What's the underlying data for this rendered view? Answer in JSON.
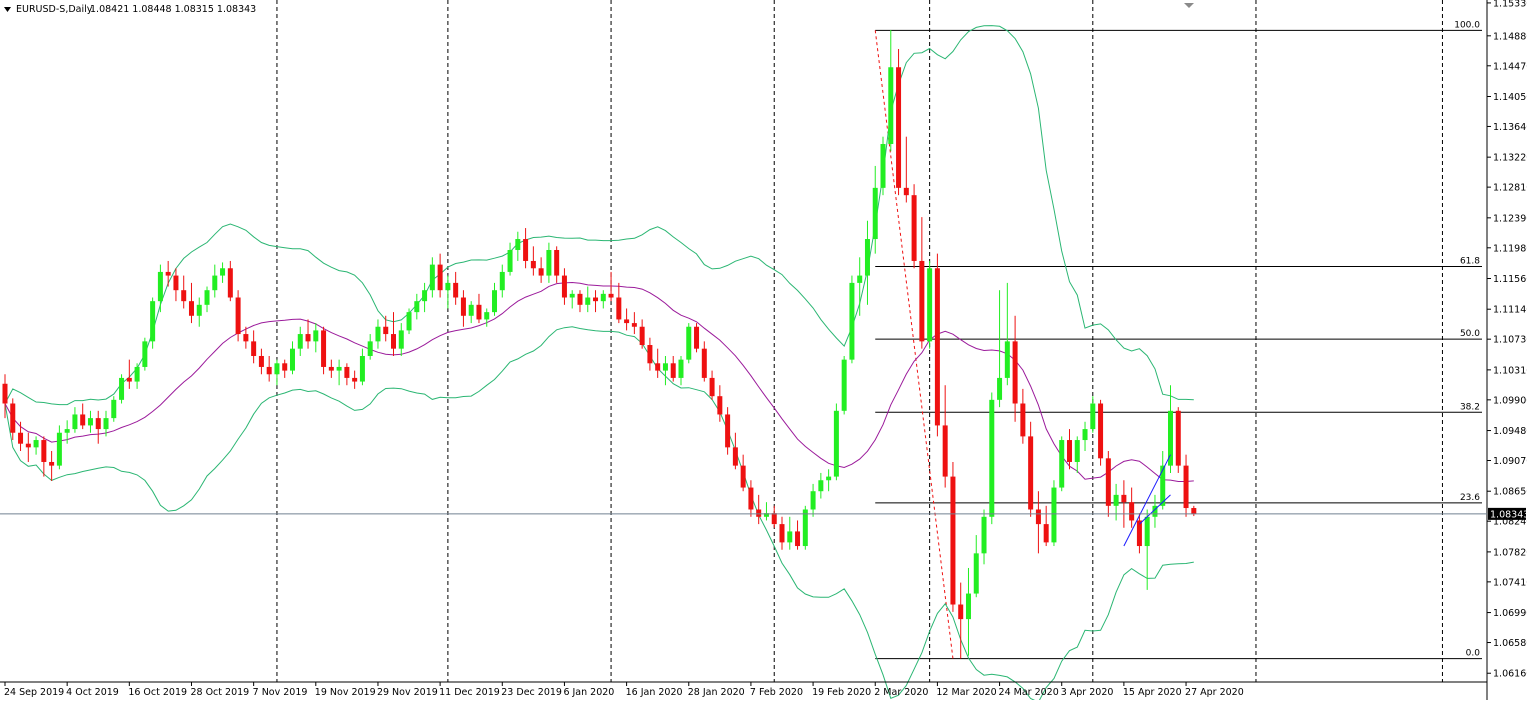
{
  "header": {
    "symbol": "EURUSD-S,Daily",
    "ohlc": "1.08421 1.08448 1.08315 1.08343"
  },
  "price_marker": "1.08343",
  "colors": {
    "bull": "#22ee22",
    "bear": "#ee1111",
    "bands": "#2bb673",
    "mid": "#9b1b9b",
    "fib": "#000000",
    "bid_line": "#708090",
    "trend": "#1a1aff"
  },
  "chart_data": {
    "type": "candlestick",
    "title": "EURUSD-S,Daily",
    "y_ticks": [
      "1.15330",
      "1.14880",
      "1.14470",
      "1.14050",
      "1.13640",
      "1.13220",
      "1.12810",
      "1.12390",
      "1.11980",
      "1.11560",
      "1.11140",
      "1.10730",
      "1.10310",
      "1.09900",
      "1.09480",
      "1.09070",
      "1.08650",
      "1.08240",
      "1.07820",
      "1.07410",
      "1.06990",
      "1.06580",
      "1.06160"
    ],
    "ylim": [
      1.0604,
      1.1537
    ],
    "x_labels": [
      "24 Sep 2019",
      "4 Oct 2019",
      "16 Oct 2019",
      "28 Oct 2019",
      "7 Nov 2019",
      "19 Nov 2019",
      "29 Nov 2019",
      "11 Dec 2019",
      "23 Dec 2019",
      "6 Jan 2020",
      "16 Jan 2020",
      "28 Jan 2020",
      "7 Feb 2020",
      "19 Feb 2020",
      "2 Mar 2020",
      "12 Mar 2020",
      "24 Mar 2020",
      "3 Apr 2020",
      "15 Apr 2020",
      "27 Apr 2020"
    ],
    "fibonacci": [
      {
        "label": "100.0",
        "price": 1.14955
      },
      {
        "label": "61.8",
        "price": 1.11725
      },
      {
        "label": "50.0",
        "price": 1.1073
      },
      {
        "label": "38.2",
        "price": 1.0973
      },
      {
        "label": "23.6",
        "price": 1.0849
      },
      {
        "label": "0.0",
        "price": 1.0636
      }
    ],
    "candles": [
      [
        1.1012,
        1.1025,
        1.0965,
        1.0985
      ],
      [
        1.0985,
        1.0992,
        1.0935,
        1.0945
      ],
      [
        1.0945,
        1.096,
        1.092,
        1.093
      ],
      [
        1.093,
        1.0945,
        1.0905,
        1.0925
      ],
      [
        1.0925,
        1.094,
        1.0915,
        1.0935
      ],
      [
        1.0935,
        1.094,
        1.0885,
        1.0905
      ],
      [
        1.0905,
        1.092,
        1.0879,
        1.09
      ],
      [
        1.09,
        1.0955,
        1.0895,
        1.0945
      ],
      [
        1.0945,
        1.0962,
        1.093,
        1.095
      ],
      [
        1.095,
        1.098,
        1.0945,
        1.097
      ],
      [
        1.097,
        1.0985,
        1.095,
        1.0955
      ],
      [
        1.0955,
        1.0975,
        1.0945,
        1.0965
      ],
      [
        1.0965,
        1.0975,
        1.093,
        1.095
      ],
      [
        1.095,
        1.0975,
        1.094,
        1.0965
      ],
      [
        1.0965,
        1.0995,
        1.096,
        1.099
      ],
      [
        1.099,
        1.1025,
        1.0985,
        1.102
      ],
      [
        1.102,
        1.1045,
        1.1005,
        1.1015
      ],
      [
        1.1015,
        1.104,
        1.1005,
        1.1035
      ],
      [
        1.1035,
        1.1075,
        1.103,
        1.107
      ],
      [
        1.107,
        1.113,
        1.106,
        1.1125
      ],
      [
        1.1125,
        1.1175,
        1.111,
        1.1165
      ],
      [
        1.1165,
        1.118,
        1.1145,
        1.116
      ],
      [
        1.116,
        1.117,
        1.1125,
        1.114
      ],
      [
        1.114,
        1.116,
        1.1115,
        1.1125
      ],
      [
        1.1125,
        1.115,
        1.1095,
        1.1105
      ],
      [
        1.1105,
        1.113,
        1.109,
        1.112
      ],
      [
        1.112,
        1.1145,
        1.111,
        1.114
      ],
      [
        1.114,
        1.1175,
        1.113,
        1.116
      ],
      [
        1.116,
        1.1178,
        1.115,
        1.117
      ],
      [
        1.117,
        1.118,
        1.1125,
        1.113
      ],
      [
        1.113,
        1.114,
        1.107,
        1.108
      ],
      [
        1.108,
        1.109,
        1.106,
        1.107
      ],
      [
        1.107,
        1.1085,
        1.104,
        1.105
      ],
      [
        1.105,
        1.106,
        1.1025,
        1.1035
      ],
      [
        1.1035,
        1.105,
        1.1015,
        1.1025
      ],
      [
        1.1025,
        1.1045,
        1.101,
        1.104
      ],
      [
        1.104,
        1.1045,
        1.102,
        1.103
      ],
      [
        1.103,
        1.107,
        1.1025,
        1.106
      ],
      [
        1.106,
        1.109,
        1.105,
        1.108
      ],
      [
        1.108,
        1.11,
        1.106,
        1.107
      ],
      [
        1.107,
        1.1095,
        1.1055,
        1.1085
      ],
      [
        1.1085,
        1.109,
        1.1025,
        1.1035
      ],
      [
        1.1035,
        1.1045,
        1.102,
        1.103
      ],
      [
        1.103,
        1.1045,
        1.101,
        1.1035
      ],
      [
        1.1035,
        1.104,
        1.101,
        1.102
      ],
      [
        1.102,
        1.103,
        1.1005,
        1.1015
      ],
      [
        1.1015,
        1.106,
        1.101,
        1.105
      ],
      [
        1.105,
        1.108,
        1.1045,
        1.107
      ],
      [
        1.107,
        1.11,
        1.106,
        1.109
      ],
      [
        1.109,
        1.1105,
        1.107,
        1.108
      ],
      [
        1.108,
        1.111,
        1.105,
        1.106
      ],
      [
        1.106,
        1.1095,
        1.105,
        1.1085
      ],
      [
        1.1085,
        1.1115,
        1.108,
        1.111
      ],
      [
        1.111,
        1.1135,
        1.11,
        1.1125
      ],
      [
        1.1125,
        1.115,
        1.111,
        1.114
      ],
      [
        1.114,
        1.1185,
        1.113,
        1.1175
      ],
      [
        1.1175,
        1.119,
        1.113,
        1.114
      ],
      [
        1.114,
        1.116,
        1.1115,
        1.115
      ],
      [
        1.115,
        1.1165,
        1.112,
        1.113
      ],
      [
        1.113,
        1.114,
        1.109,
        1.1105
      ],
      [
        1.1105,
        1.1125,
        1.1095,
        1.112
      ],
      [
        1.112,
        1.1135,
        1.1095,
        1.11
      ],
      [
        1.11,
        1.1115,
        1.109,
        1.111
      ],
      [
        1.111,
        1.115,
        1.1105,
        1.114
      ],
      [
        1.114,
        1.1175,
        1.113,
        1.1165
      ],
      [
        1.1165,
        1.1205,
        1.116,
        1.1195
      ],
      [
        1.1195,
        1.122,
        1.118,
        1.121
      ],
      [
        1.121,
        1.1225,
        1.117,
        1.118
      ],
      [
        1.118,
        1.12,
        1.116,
        1.117
      ],
      [
        1.117,
        1.1185,
        1.115,
        1.116
      ],
      [
        1.116,
        1.1205,
        1.115,
        1.1195
      ],
      [
        1.1195,
        1.12,
        1.115,
        1.116
      ],
      [
        1.116,
        1.117,
        1.112,
        1.113
      ],
      [
        1.113,
        1.114,
        1.1115,
        1.1135
      ],
      [
        1.1135,
        1.114,
        1.111,
        1.112
      ],
      [
        1.112,
        1.1145,
        1.111,
        1.113
      ],
      [
        1.113,
        1.114,
        1.111,
        1.1125
      ],
      [
        1.1125,
        1.114,
        1.1115,
        1.1135
      ],
      [
        1.1135,
        1.1165,
        1.1125,
        1.113
      ],
      [
        1.113,
        1.115,
        1.1095,
        1.11
      ],
      [
        1.11,
        1.1115,
        1.1085,
        1.1095
      ],
      [
        1.1095,
        1.111,
        1.108,
        1.109
      ],
      [
        1.109,
        1.11,
        1.106,
        1.1065
      ],
      [
        1.1065,
        1.1075,
        1.103,
        1.104
      ],
      [
        1.104,
        1.106,
        1.102,
        1.103
      ],
      [
        1.103,
        1.105,
        1.101,
        1.104
      ],
      [
        1.104,
        1.105,
        1.1015,
        1.102
      ],
      [
        1.102,
        1.105,
        1.101,
        1.1045
      ],
      [
        1.1045,
        1.1095,
        1.104,
        1.109
      ],
      [
        1.109,
        1.1095,
        1.1055,
        1.106
      ],
      [
        1.106,
        1.107,
        1.1015,
        1.102
      ],
      [
        1.102,
        1.103,
        1.099,
        1.0995
      ],
      [
        1.0995,
        1.101,
        1.096,
        1.097
      ],
      [
        1.097,
        1.098,
        1.0915,
        1.0925
      ],
      [
        1.0925,
        1.0945,
        1.0895,
        1.09
      ],
      [
        1.09,
        1.0915,
        1.0865,
        1.087
      ],
      [
        1.087,
        1.088,
        1.083,
        1.084
      ],
      [
        1.084,
        1.086,
        1.082,
        1.083
      ],
      [
        1.083,
        1.085,
        1.0825,
        1.0835
      ],
      [
        1.0835,
        1.0845,
        1.0815,
        1.082
      ],
      [
        1.082,
        1.083,
        1.0785,
        1.0795
      ],
      [
        1.0795,
        1.083,
        1.0785,
        1.081
      ],
      [
        1.081,
        1.0825,
        1.0785,
        1.079
      ],
      [
        1.079,
        1.0845,
        1.0785,
        1.084
      ],
      [
        1.084,
        1.0875,
        1.083,
        1.0865
      ],
      [
        1.0865,
        1.089,
        1.0855,
        1.088
      ],
      [
        1.088,
        1.0895,
        1.0865,
        1.0885
      ],
      [
        1.0885,
        1.0985,
        1.088,
        1.0975
      ],
      [
        1.0975,
        1.105,
        1.097,
        1.1045
      ],
      [
        1.1045,
        1.116,
        1.104,
        1.115
      ],
      [
        1.115,
        1.1185,
        1.1105,
        1.116
      ],
      [
        1.116,
        1.1235,
        1.112,
        1.121
      ],
      [
        1.121,
        1.131,
        1.119,
        1.128
      ],
      [
        1.128,
        1.135,
        1.127,
        1.134
      ],
      [
        1.134,
        1.1496,
        1.133,
        1.1445
      ],
      [
        1.1445,
        1.147,
        1.127,
        1.128
      ],
      [
        1.128,
        1.135,
        1.126,
        1.127
      ],
      [
        1.127,
        1.1285,
        1.117,
        1.118
      ],
      [
        1.118,
        1.124,
        1.106,
        1.107
      ],
      [
        1.107,
        1.118,
        1.106,
        1.117
      ],
      [
        1.117,
        1.119,
        1.094,
        1.0955
      ],
      [
        1.0955,
        1.101,
        1.087,
        1.0885
      ],
      [
        1.0885,
        1.0905,
        1.07,
        1.071
      ],
      [
        1.071,
        1.074,
        1.0636,
        1.069
      ],
      [
        1.069,
        1.076,
        1.064,
        1.0725
      ],
      [
        1.0725,
        1.0805,
        1.072,
        1.078
      ],
      [
        1.078,
        1.084,
        1.0765,
        1.083
      ],
      [
        1.083,
        1.1,
        1.082,
        1.099
      ],
      [
        1.099,
        1.114,
        1.098,
        1.102
      ],
      [
        1.102,
        1.115,
        1.101,
        1.107
      ],
      [
        1.107,
        1.1105,
        1.096,
        1.0985
      ],
      [
        1.0985,
        1.1005,
        1.093,
        1.094
      ],
      [
        1.094,
        1.096,
        1.083,
        1.084
      ],
      [
        1.084,
        1.0865,
        1.078,
        1.082
      ],
      [
        1.082,
        1.0845,
        1.079,
        1.0795
      ],
      [
        1.0795,
        1.088,
        1.079,
        1.087
      ],
      [
        1.087,
        1.094,
        1.0865,
        1.0935
      ],
      [
        1.0935,
        1.095,
        1.0895,
        1.0905
      ],
      [
        1.0905,
        1.094,
        1.089,
        1.0935
      ],
      [
        1.0935,
        1.096,
        1.092,
        1.095
      ],
      [
        1.095,
        1.0995,
        1.0945,
        1.0985
      ],
      [
        1.0985,
        1.099,
        1.09,
        1.091
      ],
      [
        1.091,
        1.092,
        1.083,
        1.0845
      ],
      [
        1.0845,
        1.0875,
        1.0825,
        1.086
      ],
      [
        1.086,
        1.088,
        1.0815,
        1.085
      ],
      [
        1.085,
        1.087,
        1.0815,
        1.0825
      ],
      [
        1.0825,
        1.0835,
        1.078,
        1.079
      ],
      [
        1.079,
        1.084,
        1.073,
        1.083
      ],
      [
        1.083,
        1.086,
        1.0815,
        1.0845
      ],
      [
        1.0845,
        1.092,
        1.084,
        1.09
      ],
      [
        1.09,
        1.101,
        1.089,
        1.0975
      ],
      [
        1.0975,
        1.098,
        1.089,
        1.09
      ],
      [
        1.09,
        1.0915,
        1.083,
        1.0842
      ],
      [
        1.0842,
        1.0845,
        1.0831,
        1.0834
      ]
    ]
  }
}
